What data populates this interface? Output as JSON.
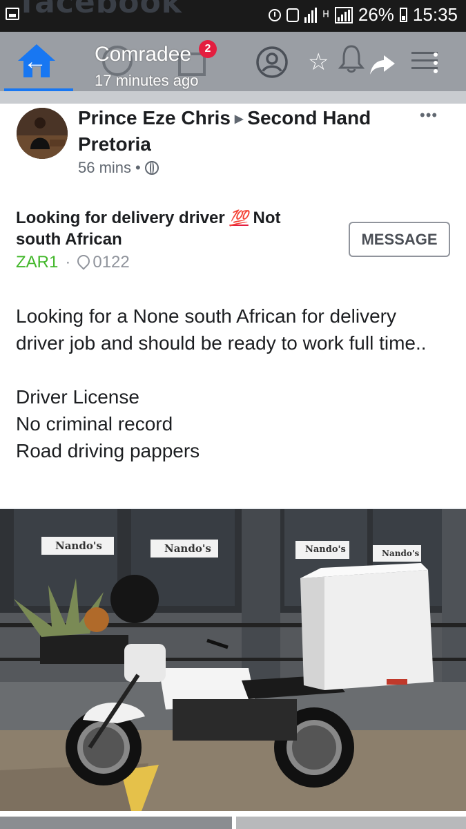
{
  "status_bar": {
    "background_brand_text": "facebook",
    "network_type": "H",
    "battery": "26%",
    "time": "15:35"
  },
  "toolbar": {
    "notification_count": "2",
    "title": "Comradee",
    "subtitle": "17 minutes ago",
    "icons": [
      "home-icon",
      "back-arrow-icon",
      "profile-icon",
      "star-icon",
      "bell-icon",
      "share-icon",
      "menu-icon",
      "more-vertical-icon"
    ]
  },
  "post": {
    "author": "Prince Eze Chris",
    "group": "Second Hand Pretoria",
    "timestamp": "56 mins",
    "privacy_icon": "globe-icon",
    "more_label": "•••",
    "listing": {
      "title_start": "Looking for delivery driver",
      "emoji": "💯",
      "title_end": "Not south African",
      "price": "ZAR1",
      "separator": "·",
      "location": "0122",
      "message_button": "MESSAGE"
    },
    "body": "Looking for a None south African for delivery driver job and should be ready to work full time..\n\nDriver License\nNo criminal record\nRoad driving pappers",
    "photo": {
      "signs": [
        "Nando's",
        "Nando's",
        "Nando's",
        "Nando's"
      ]
    }
  },
  "colors": {
    "accent": "#1877f2",
    "price_green": "#42b72a",
    "badge_red": "#e41e3f"
  }
}
